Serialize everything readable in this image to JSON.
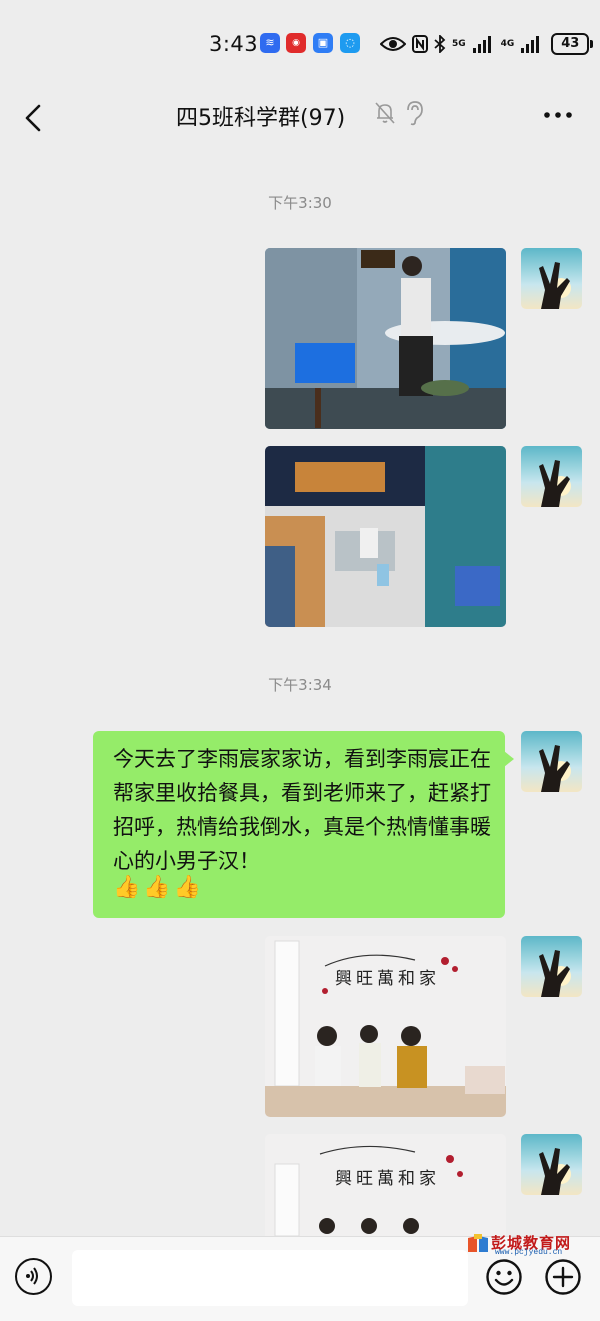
{
  "status_bar": {
    "time": "3:43",
    "network_5g": "5G",
    "network_4g": "4G",
    "battery": "43"
  },
  "chat": {
    "title": "四5班科学群(97)"
  },
  "timestamps": [
    "下午3:30",
    "下午3:34"
  ],
  "messages": {
    "text_message": "今天去了李雨宸家家访，看到李雨宸正在帮家里收拾餐具，看到老师来了，赶紧打招呼，热情给我倒水，真是个热情懂事暖心的小男子汉！",
    "emoji_thumbs": [
      "👍",
      "👍",
      "👍"
    ]
  },
  "photo_content": {
    "banner_calligraphy": "興旺萬和家"
  },
  "input": {
    "placeholder": ""
  },
  "watermark": {
    "title": "彭城教育网",
    "url": "www.pcjyedu.cn"
  },
  "colors": {
    "background": "#ededed",
    "bubble": "#95ec69",
    "input_bar": "#f7f7f7"
  }
}
